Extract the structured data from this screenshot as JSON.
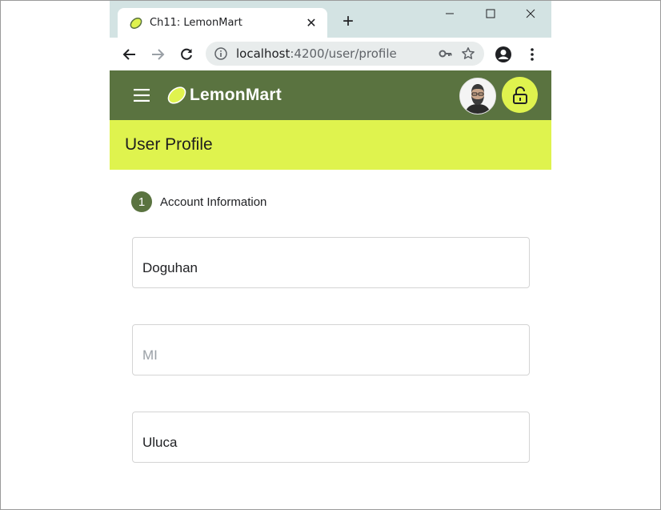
{
  "browser": {
    "tab_title": "Ch11: LemonMart",
    "url_host": "localhost",
    "url_rest": ":4200/user/profile"
  },
  "app": {
    "brand": "LemonMart",
    "accent_color": "#dff34e",
    "primary_color": "#5a7340"
  },
  "page": {
    "title": "User Profile"
  },
  "stepper": {
    "step_number": "1",
    "step_label": "Account Information"
  },
  "form": {
    "first_name": {
      "value": "Doguhan",
      "placeholder": ""
    },
    "middle_initial": {
      "value": "",
      "placeholder": "MI"
    },
    "last_name": {
      "value": "Uluca",
      "placeholder": ""
    }
  },
  "icons": [
    "lemon-favicon-icon",
    "close-icon",
    "plus-icon",
    "minimize-icon",
    "maximize-icon",
    "window-close-icon",
    "back-icon",
    "forward-icon",
    "reload-icon",
    "info-icon",
    "key-icon",
    "star-icon",
    "account-icon",
    "kebab-icon",
    "hamburger-icon",
    "lemon-logo-icon",
    "lock-open-icon"
  ]
}
